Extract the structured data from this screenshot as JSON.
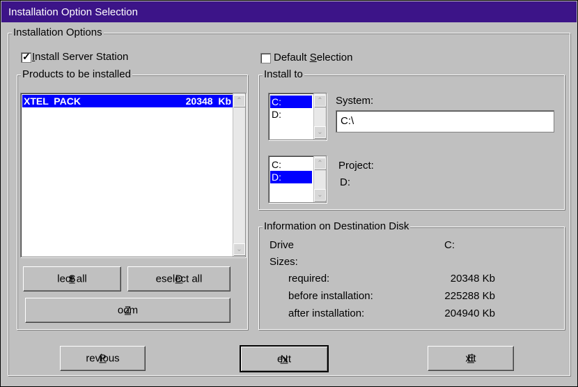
{
  "window": {
    "title": "Installation Option Selection"
  },
  "install_options": {
    "legend": "Installation Options",
    "server_station": {
      "label_pre": "",
      "label_ul": "I",
      "label_post": "nstall Server Station",
      "checked": true
    },
    "default_selection": {
      "label_pre": "Default ",
      "label_ul": "S",
      "label_post": "election",
      "checked": false
    }
  },
  "products": {
    "legend": "Products to be installed",
    "items": [
      {
        "name": "XTEL  PACK",
        "size": "20348  Kb",
        "selected": true
      }
    ],
    "select_all": {
      "pre": "S",
      "ul": "e",
      "post": "lect all"
    },
    "deselect_all": {
      "pre": "",
      "ul": "D",
      "post": "eselect all"
    },
    "zoom": {
      "pre": "",
      "ul": "Z",
      "post": "oom"
    }
  },
  "install_to": {
    "legend": "Install to",
    "system": {
      "label": "System:",
      "drives": [
        "C:",
        "D:"
      ],
      "selected_drive": "C:",
      "path": "C:\\"
    },
    "project": {
      "label": "Project:",
      "drives": [
        "C:",
        "D:"
      ],
      "selected_drive": "D:",
      "value": "D:"
    }
  },
  "disk_info": {
    "legend": "Information on Destination Disk",
    "drive_label": "Drive",
    "drive_value": "C:",
    "sizes_label": "Sizes:",
    "required_label": "required:",
    "required_value": "20348 Kb",
    "before_label": "before installation:",
    "before_value": "225288 Kb",
    "after_label": "after installation:",
    "after_value": "204940 Kb"
  },
  "nav": {
    "previous": {
      "pre": "",
      "ul": "P",
      "post": "revious"
    },
    "next": {
      "pre": "",
      "ul": "N",
      "post": "ext"
    },
    "exit": {
      "pre": "",
      "ul": "E",
      "post": "xit"
    }
  }
}
